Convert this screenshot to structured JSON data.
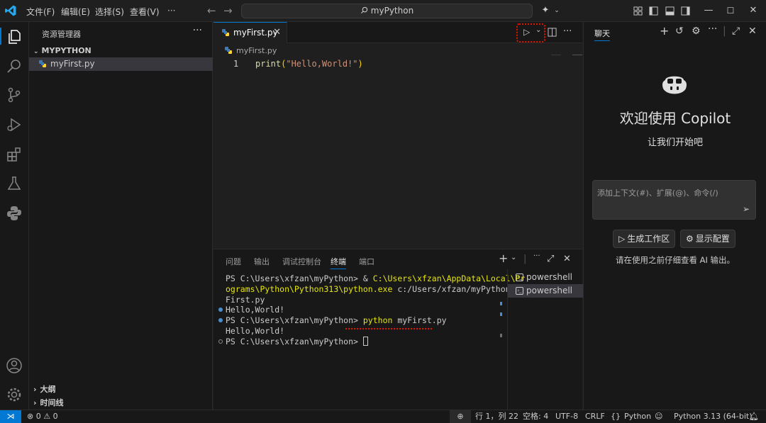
{
  "titlebar": {
    "menus": [
      "文件(F)",
      "编辑(E)",
      "选择(S)",
      "查看(V)",
      "···"
    ],
    "search_text": "myPython"
  },
  "sidebar": {
    "title": "资源管理器",
    "more": "···",
    "folder": "MYPYTHON",
    "file": "myFirst.py",
    "outline": "大纲",
    "timeline": "时间线"
  },
  "editor": {
    "tab_label": "myFirst.py",
    "tab_close": "✕",
    "breadcrumb": "myFirst.py",
    "line_number": "1",
    "code": {
      "func": "print",
      "open": "(",
      "string": "\"Hello,World!\"",
      "close": ")"
    },
    "more": "···"
  },
  "panel": {
    "tabs": [
      "问题",
      "输出",
      "调试控制台",
      "终端",
      "端口"
    ],
    "active_tab": "终端",
    "terminal": {
      "l1_prompt": "PS C:\\Users\\xfzan\\myPython> & ",
      "l1_path": "C:\\Users\\xfzan\\AppData\\Local\\Pr",
      "l2_path": "ograms\\Python\\Python313\\python.exe",
      "l2_rest": " c:/Users/xfzan/myPython/my",
      "l3": "First.py",
      "l4": "Hello,World!",
      "l5_prompt": "PS C:\\Users\\xfzan\\myPython> ",
      "l5_cmd": "python",
      "l5_rest": " myFirst.py",
      "l6": "Hello,World!",
      "l7": "PS C:\\Users\\xfzan\\myPython> "
    },
    "terminals": [
      "powershell",
      "powershell"
    ]
  },
  "chat": {
    "tab": "聊天",
    "welcome": "欢迎使用 Copilot",
    "subtitle": "让我们开始吧",
    "input_placeholder": "添加上下文(#)、扩展(@)、命令(/)",
    "buttons": [
      "生成工作区",
      "显示配置"
    ],
    "note": "请在使用之前仔细查看 AI 输出。"
  },
  "statusbar": {
    "problems": "⊗ 0 ⚠ 0",
    "position": "行 1，列 22",
    "spaces": "空格: 4",
    "encoding": "UTF-8",
    "eol": "CRLF",
    "language": "Python",
    "interpreter": "Python 3.13 (64-bit)"
  },
  "colors": {
    "accent": "#0078d4",
    "highlight": "#e51400",
    "terminal_yellow": "#e5e510",
    "string": "#ce9178",
    "function": "#dcdcaa"
  }
}
